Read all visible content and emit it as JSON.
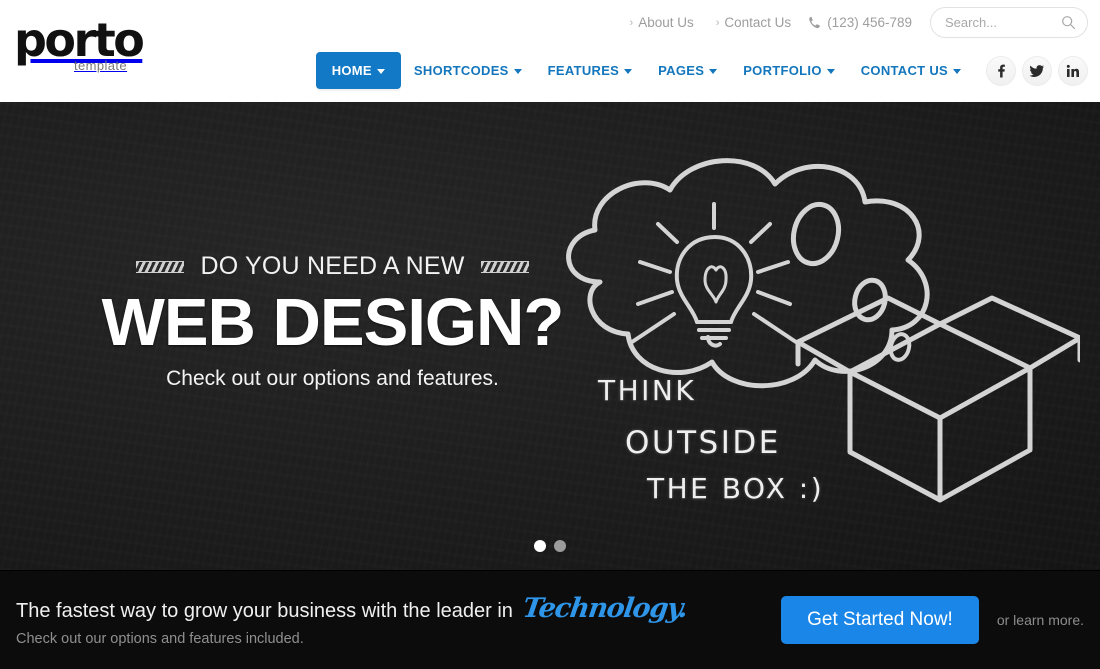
{
  "brand": {
    "name": "porto",
    "tagline": "template"
  },
  "topbar": {
    "links": [
      {
        "label": "About Us",
        "icon": "chevron-right-icon"
      },
      {
        "label": "Contact Us",
        "icon": "chevron-right-icon"
      }
    ],
    "phone": {
      "number": "(123) 456-789",
      "icon": "phone-icon"
    },
    "search": {
      "placeholder": "Search...",
      "value": "",
      "icon": "search-icon"
    }
  },
  "nav": {
    "items": [
      {
        "label": "HOME",
        "active": true,
        "caret": true
      },
      {
        "label": "SHORTCODES",
        "active": false,
        "caret": true
      },
      {
        "label": "FEATURES",
        "active": false,
        "caret": true
      },
      {
        "label": "PAGES",
        "active": false,
        "caret": true
      },
      {
        "label": "PORTFOLIO",
        "active": false,
        "caret": true
      },
      {
        "label": "CONTACT US",
        "active": false,
        "caret": true
      }
    ],
    "socials": [
      {
        "name": "facebook-icon",
        "glyph": "f"
      },
      {
        "name": "twitter-icon",
        "glyph": "t"
      },
      {
        "name": "linkedin-icon",
        "glyph": "in"
      }
    ],
    "accent_color": "#1279c6",
    "link_color": "#1476bc"
  },
  "hero": {
    "kicker": "DO YOU NEED A NEW",
    "headline": "WEB DESIGN?",
    "subline": "Check out our options and features.",
    "chalk_text": {
      "line1": "THINK",
      "line2": "OUTSIDE",
      "line3": "THE BOX :)"
    },
    "background_color": "#1e1e1e",
    "slides": [
      {
        "label": "1",
        "active": true
      },
      {
        "label": "2",
        "active": false
      }
    ]
  },
  "cta": {
    "heading": "The fastest way to grow your business with the leader in",
    "heading_accent": "Technology.",
    "subheading": "Check out our options and features included.",
    "button_label": "Get Started Now!",
    "secondary_text": "or learn more.",
    "button_color": "#1a86e8",
    "accent_color": "#2f95e8",
    "background_color": "#0c0c0c"
  }
}
